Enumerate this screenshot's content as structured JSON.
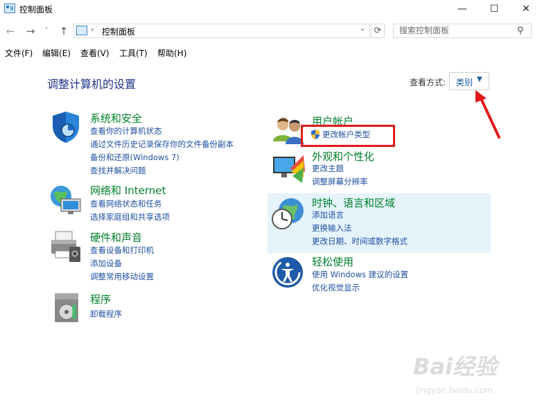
{
  "window": {
    "title": "控制面板",
    "minimize": "—",
    "maximize": "☐",
    "close": "✕"
  },
  "nav": {
    "back": "←",
    "forward": "→",
    "recent": "˅",
    "up": "↑",
    "address_separator": "›",
    "address": "控制面板",
    "address_dropdown": "⌄",
    "refresh": "⟳",
    "search_placeholder": "搜索控制面板",
    "search_icon": "⚲"
  },
  "menu": [
    "文件(F)",
    "编辑(E)",
    "查看(V)",
    "工具(T)",
    "帮助(H)"
  ],
  "main": {
    "page_title": "调整计算机的设置",
    "view_by_label": "查看方式:",
    "view_by_value": "类别",
    "view_by_arrow": "▼"
  },
  "categories_left": [
    {
      "icon": "shield-icon",
      "title": "系统和安全",
      "links": [
        "查看你的计算机状态",
        "通过文件历史记录保存你的文件备份副本",
        "备份和还原(Windows 7)",
        "查找并解决问题"
      ]
    },
    {
      "icon": "network-icon",
      "title": "网络和 Internet",
      "links": [
        "查看网络状态和任务",
        "选择家庭组和共享选项"
      ]
    },
    {
      "icon": "printer-icon",
      "title": "硬件和声音",
      "links": [
        "查看设备和打印机",
        "添加设备",
        "调整常用移动设置"
      ]
    },
    {
      "icon": "programs-icon",
      "title": "程序",
      "links": [
        "卸载程序"
      ]
    }
  ],
  "categories_right": [
    {
      "icon": "users-icon",
      "title": "用户帐户",
      "links": [
        "更改帐户类型"
      ]
    },
    {
      "icon": "appearance-icon",
      "title": "外观和个性化",
      "links": [
        "更改主题",
        "调整屏幕分辨率"
      ]
    },
    {
      "icon": "clock-globe-icon",
      "title": "时钟、语言和区域",
      "links": [
        "添加语言",
        "更换输入法",
        "更改日期、时间或数字格式"
      ]
    },
    {
      "icon": "ease-of-access-icon",
      "title": "轻松使用",
      "links": [
        "使用 Windows 建议的设置",
        "优化视觉显示"
      ]
    }
  ],
  "colors": {
    "category_title": "#00802b",
    "link": "#1f4fa0",
    "page_title": "#1e3287",
    "annotation": "#e21a1a",
    "hover_region": "#e5f3fb"
  },
  "watermark": {
    "text": "Bai经验",
    "url": "jingyan.baidu.com"
  }
}
